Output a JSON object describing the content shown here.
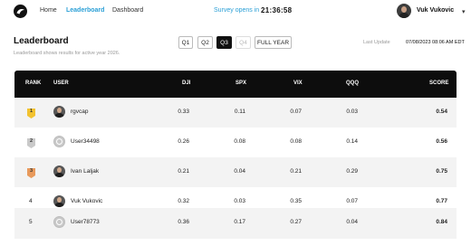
{
  "nav": {
    "links": [
      {
        "label": "Home"
      },
      {
        "label": "Leaderboard"
      },
      {
        "label": "Dashboard"
      }
    ],
    "survey_label": "Survey opens in",
    "timer": "21:36:58",
    "profile_name": "Vuk Vukovic",
    "active_color": "#2a9fd6"
  },
  "header": {
    "title": "Leaderboard",
    "subtitle": "Leaderboard shows results for active year 2026.",
    "periods": [
      "Q1",
      "Q2",
      "Q3",
      "Q4",
      "FULL YEAR"
    ],
    "selected_period": "Q3",
    "disabled_period": "Q4",
    "last_update_label": "Last Update",
    "last_update_value": "07/08/2023 08:06 AM EDT"
  },
  "table": {
    "columns": [
      "RANK",
      "USER",
      "DJI",
      "SPX",
      "VIX",
      "QQQ",
      "SCORE"
    ],
    "rows": [
      {
        "rank": "1",
        "user": "rgvcap",
        "avatar": "photo-icon",
        "dji": "0.33",
        "spx": "0.11",
        "vix": "0.07",
        "qqq": "0.03",
        "score": "0.54"
      },
      {
        "rank": "2",
        "user": "User34498",
        "avatar": "default-avatar-icon",
        "dji": "0.26",
        "spx": "0.08",
        "vix": "0.08",
        "qqq": "0.14",
        "score": "0.56"
      },
      {
        "rank": "3",
        "user": "Ivan Laljak",
        "avatar": "photo-icon",
        "dji": "0.21",
        "spx": "0.04",
        "vix": "0.21",
        "qqq": "0.29",
        "score": "0.75"
      },
      {
        "rank": "4",
        "user": "Vuk Vukovic",
        "avatar": "photo-icon",
        "dji": "0.32",
        "spx": "0.03",
        "vix": "0.35",
        "qqq": "0.07",
        "score": "0.77"
      },
      {
        "rank": "5",
        "user": "User78773",
        "avatar": "default-avatar-icon",
        "dji": "0.36",
        "spx": "0.17",
        "vix": "0.27",
        "qqq": "0.04",
        "score": "0.84"
      }
    ],
    "medal_colors": {
      "gold": "#f2c230",
      "silver": "#c9c9c9",
      "bronze": "#e89a5c"
    }
  }
}
